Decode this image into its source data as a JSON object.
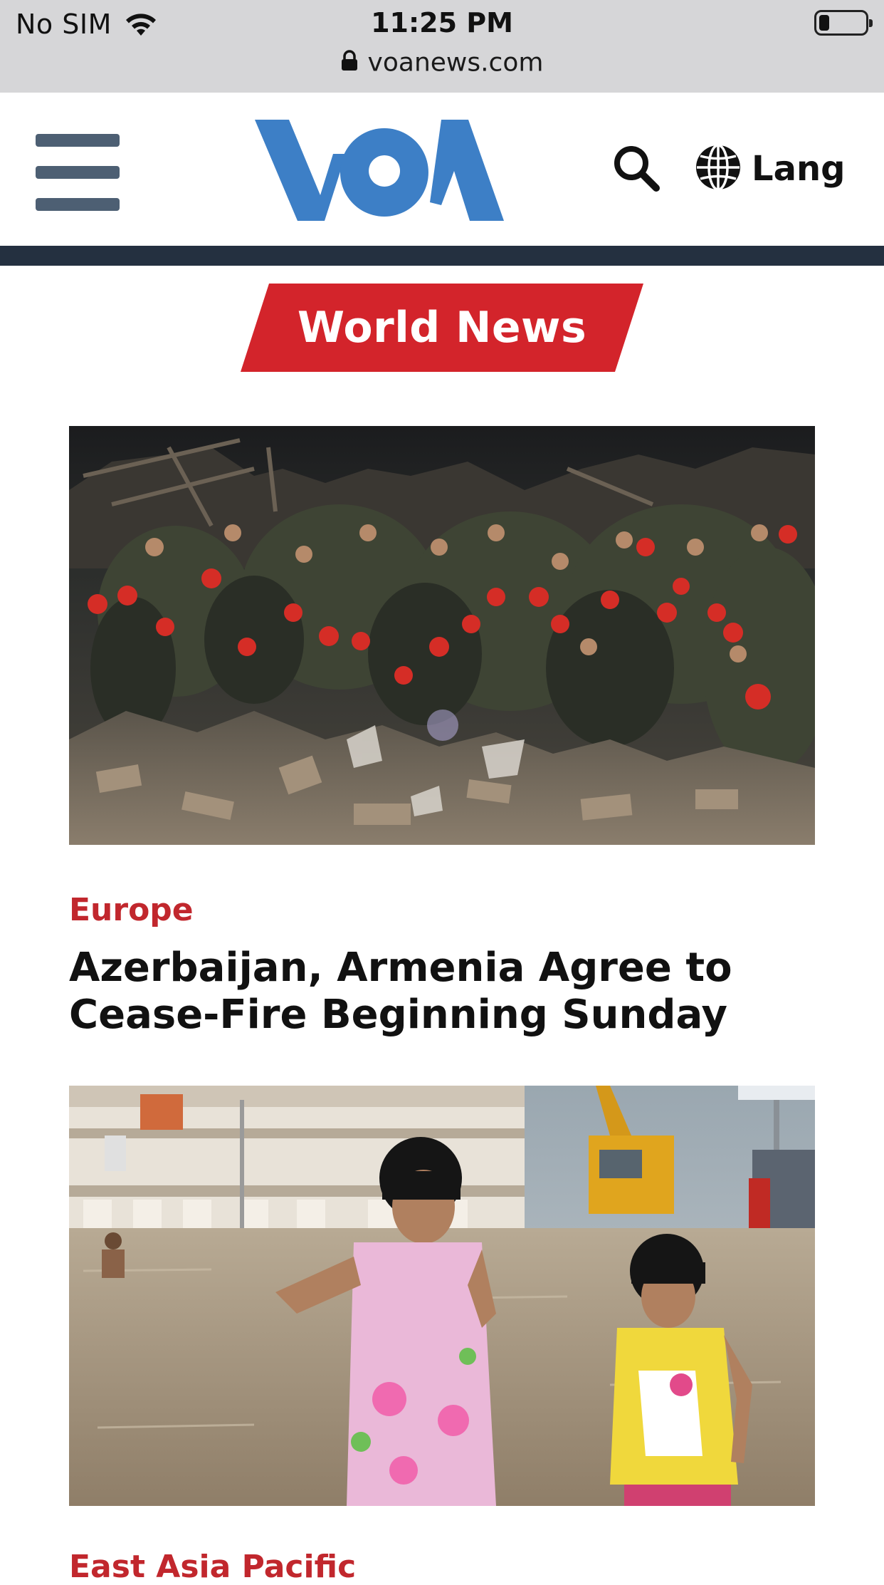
{
  "status_bar": {
    "carrier": "No SIM",
    "time": "11:25 PM",
    "url": "voanews.com"
  },
  "header": {
    "logo_alt": "VOA",
    "lang_label": "Lang",
    "colors": {
      "logo": "#3d7fc6",
      "menu_icon": "#4d5f73",
      "dark_bar": "#243040"
    }
  },
  "section": {
    "title": "World News",
    "color": "#d3242b"
  },
  "articles": [
    {
      "category": "Europe",
      "headline": "Azerbaijan, Armenia Agree to Cease-Fire Beginning Sunday",
      "image": "rescue-workers-rubble-photo"
    },
    {
      "category": "East Asia Pacific",
      "image": "children-flood-photo"
    }
  ]
}
